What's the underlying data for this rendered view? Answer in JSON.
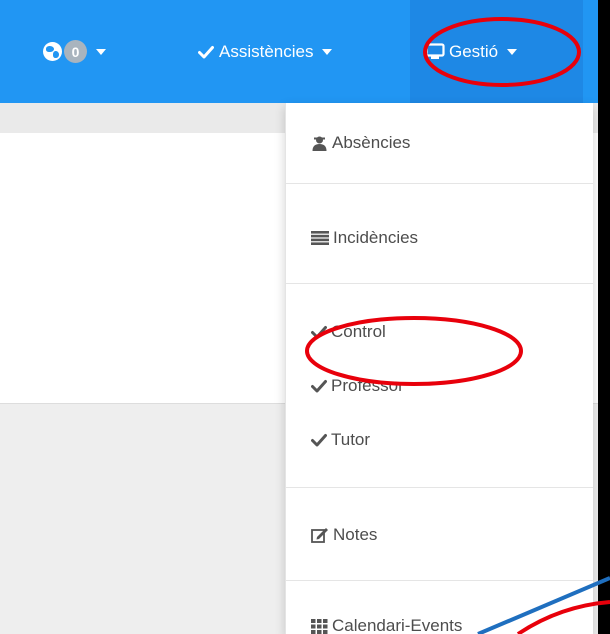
{
  "navbar": {
    "notifications_count": "0",
    "assistencies_label": "Assistències",
    "gestio_label": "Gestió"
  },
  "dropdown": {
    "absencies": "Absències",
    "incidencies": "Incidències",
    "control": "Control",
    "professor": "Professor",
    "tutor": "Tutor",
    "notes": "Notes",
    "calendari": "Calendari-Events"
  },
  "colors": {
    "navbar": "#2196f3",
    "navbar_active": "#1e88e5",
    "annotation_red": "#e8000b",
    "annotation_blue": "#1f6fbf"
  }
}
